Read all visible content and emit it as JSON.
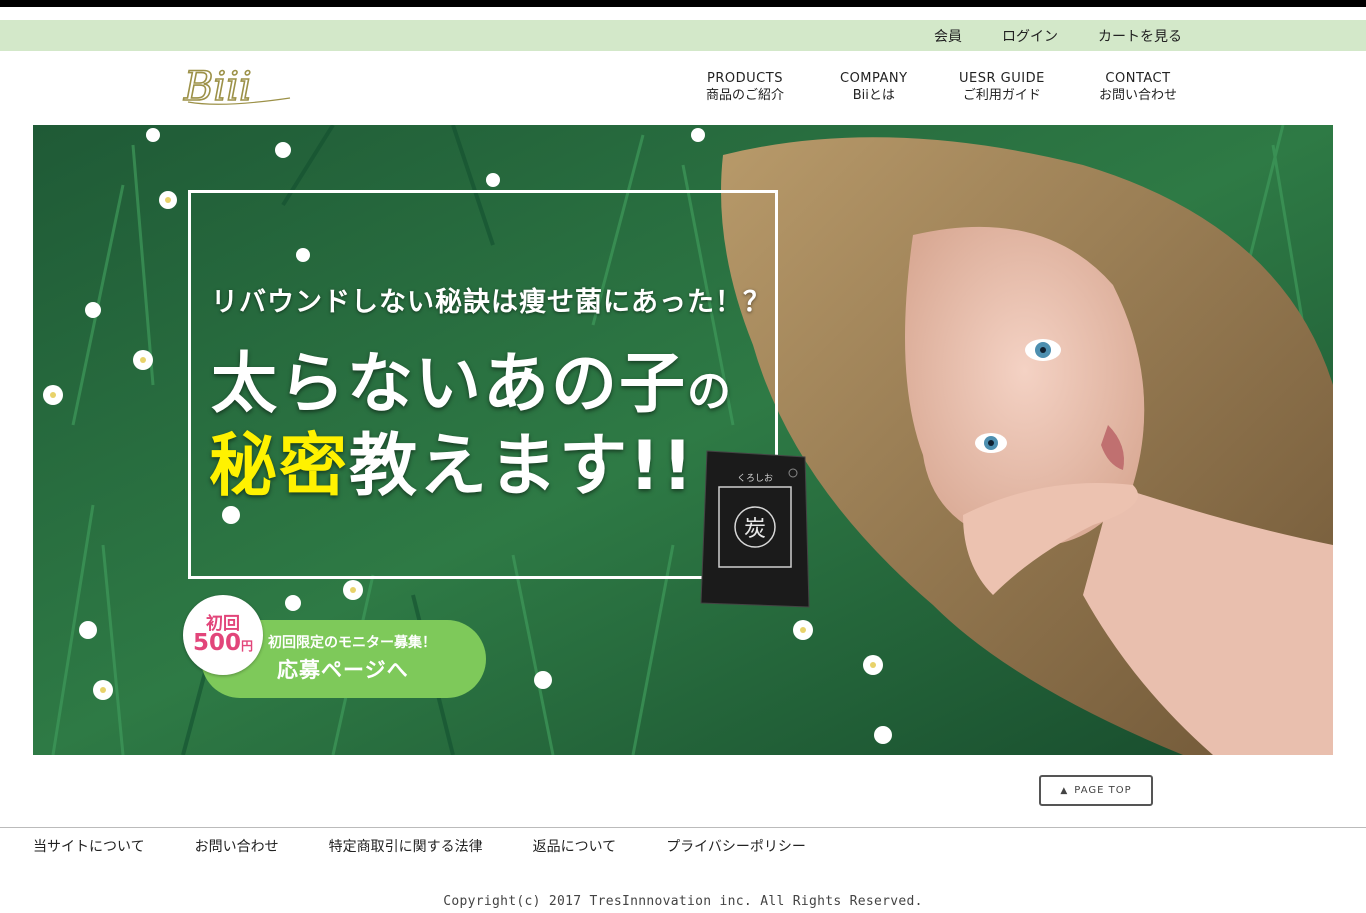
{
  "member_bar": {
    "links": [
      "会員",
      "ログイン",
      "カートを見る"
    ]
  },
  "logo": {
    "text": "Biii"
  },
  "gnav": [
    {
      "en": "PRODUCTS",
      "jp": "商品のご紹介"
    },
    {
      "en": "COMPANY",
      "jp": "Biiとは"
    },
    {
      "en": "UESR GUIDE",
      "jp": "ご利用ガイド"
    },
    {
      "en": "CONTACT",
      "jp": "お問い合わせ"
    }
  ],
  "hero": {
    "sub_copy": "リバウンドしない秘訣は痩せ菌にあった！？",
    "main_line1_big": "太らないあの子",
    "main_line1_small": "の",
    "main_line2_highlight": "秘密",
    "main_line2_rest": "教えます!!",
    "package_label": "炭",
    "package_sub": "くろしお",
    "colors": {
      "highlight": "#fff200",
      "cta": "#7ec95a",
      "badge_text": "#e2457a"
    }
  },
  "badge": {
    "line1": "初回",
    "price": "500",
    "yen": "円"
  },
  "cta": {
    "line1": "初回限定のモニター募集！",
    "line2": "応募ページへ"
  },
  "page_top": {
    "arrow": "▲",
    "label": "PAGE TOP"
  },
  "footer": {
    "links": [
      "当サイトについて",
      "お問い合わせ",
      "特定商取引に関する法律",
      "返品について",
      "プライバシーポリシー"
    ],
    "copyright": "Copyright(c) 2017 TresInnnovation inc. All Rights Reserved."
  }
}
